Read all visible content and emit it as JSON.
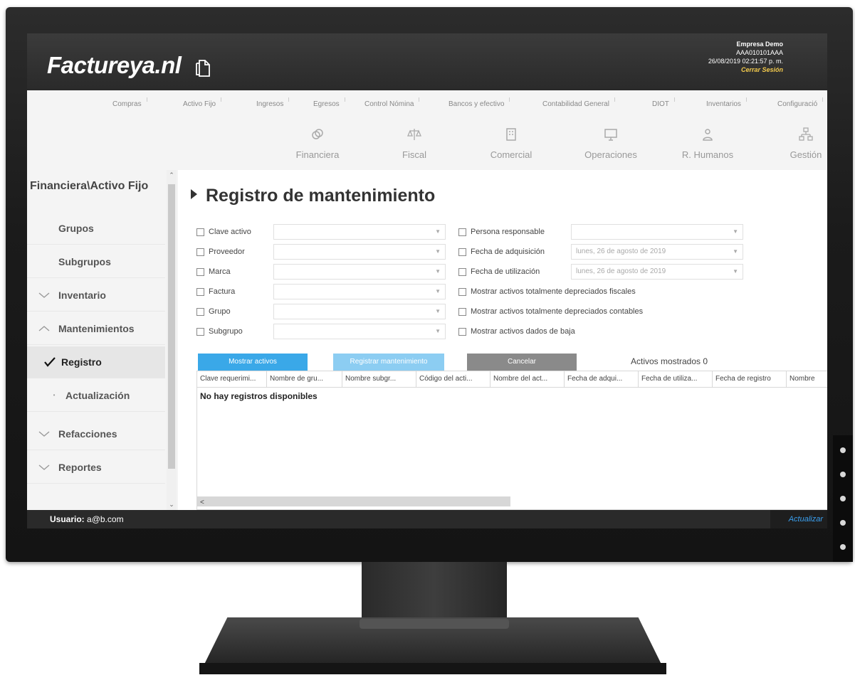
{
  "header": {
    "logo": "Factureya.nl",
    "company_name": "Empresa Demo",
    "rfc": "AAA010101AAA",
    "datetime": "26/08/2019 02:21:57 p. m.",
    "logout": "Cerrar Sesión"
  },
  "menu": [
    "Compras",
    "Activo Fijo",
    "Ingresos",
    "Egresos",
    "Control Nómina",
    "Bancos y efectivo",
    "Contabilidad General",
    "DIOT",
    "Inventarios",
    "Configuració"
  ],
  "modules": [
    {
      "label": "Financiera",
      "icon": "link-icon"
    },
    {
      "label": "Fiscal",
      "icon": "scale-icon"
    },
    {
      "label": "Comercial",
      "icon": "building-icon"
    },
    {
      "label": "Operaciones",
      "icon": "monitor-icon"
    },
    {
      "label": "R. Humanos",
      "icon": "person-icon"
    },
    {
      "label": "Gestión",
      "icon": "org-chart-icon"
    }
  ],
  "sidebar": {
    "title": "Financiera\\Activo Fijo",
    "items": [
      {
        "label": "Grupos",
        "icon": ""
      },
      {
        "label": "Subgrupos",
        "icon": ""
      },
      {
        "label": "Inventario",
        "icon": "chevron-down-icon"
      },
      {
        "label": "Mantenimientos",
        "icon": "chevron-up-icon"
      },
      {
        "label": "Registro",
        "icon": "checkmark-icon"
      },
      {
        "label": "Actualización",
        "icon": "bullet-icon"
      },
      {
        "label": "Refacciones",
        "icon": "chevron-down-icon"
      },
      {
        "label": "Reportes",
        "icon": "chevron-down-icon"
      }
    ]
  },
  "page": {
    "title": "Registro de mantenimiento"
  },
  "filters_left": [
    "Clave activo",
    "Proveedor",
    "Marca",
    "Factura",
    "Grupo",
    "Subgrupo"
  ],
  "filters_right": [
    {
      "label": "Persona responsable",
      "value": ""
    },
    {
      "label": "Fecha de adquisición",
      "value": "lunes, 26 de agosto de 2019"
    },
    {
      "label": "Fecha de utilización",
      "value": "lunes, 26 de agosto de 2019"
    }
  ],
  "options": [
    "Mostrar activos totalmente depreciados fiscales",
    "Mostrar activos totalmente depreciados contables",
    "Mostrar activos dados de baja"
  ],
  "buttons": {
    "show": "Mostrar activos",
    "register": "Registrar mantenimiento",
    "cancel": "Cancelar"
  },
  "shown_count": "Activos mostrados 0",
  "grid": {
    "columns": [
      "Clave requerimi...",
      "Nombre de gru...",
      "Nombre subgr...",
      "Código del acti...",
      "Nombre del act...",
      "Fecha de adqui...",
      "Fecha de utiliza...",
      "Fecha de registro",
      "Nombre"
    ],
    "empty": "No hay registros disponibles"
  },
  "footer": {
    "user_label": "Usuario:",
    "user": "a@b.com",
    "update": "Actualizar"
  },
  "colors": {
    "primary_button": "#3aa8e8",
    "disabled_button": "#8ccdf2",
    "cancel_button": "#8a8a8a",
    "logout": "#f2c94c",
    "update_link": "#3aa0f0"
  }
}
